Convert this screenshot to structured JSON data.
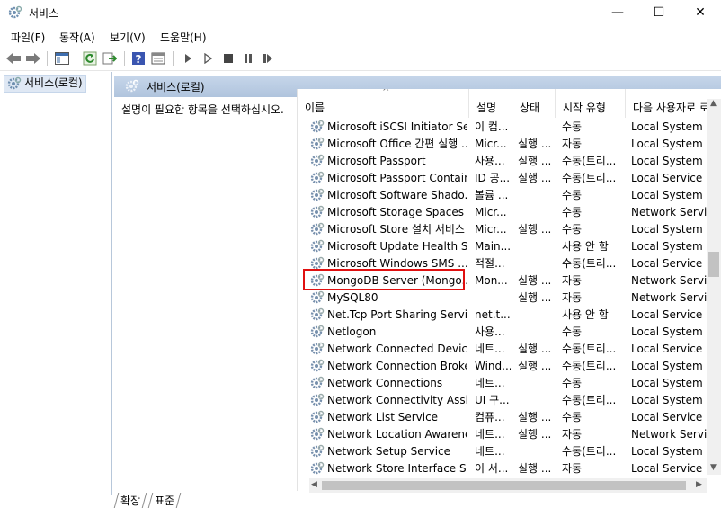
{
  "window": {
    "title": "서비스",
    "minimize": "—",
    "maximize": "☐",
    "close": "✕"
  },
  "menu": [
    "파일(F)",
    "동작(A)",
    "보기(V)",
    "도움말(H)"
  ],
  "toolbar": {
    "icons": [
      "back-arrow-icon",
      "forward-arrow-icon",
      "show-hide-tree-icon",
      "refresh-icon",
      "export-list-icon",
      "help-icon",
      "properties-icon",
      "start-service-icon",
      "start-service-alt-icon",
      "stop-service-icon",
      "pause-service-icon",
      "restart-service-icon"
    ]
  },
  "tree": {
    "label": "서비스(로컬)"
  },
  "pane": {
    "title": "서비스(로컬)",
    "description": "설명이 필요한 항목을 선택하십시오."
  },
  "columns": [
    "이름",
    "설명",
    "상태",
    "시작 유형",
    "다음 사용자로 로그온"
  ],
  "rows": [
    {
      "name": "Microsoft iSCSI Initiator Se...",
      "desc": "이 컴...",
      "status": "",
      "startup": "수동",
      "logon": "Local System"
    },
    {
      "name": "Microsoft Office 간편 실행 ...",
      "desc": "Micr...",
      "status": "실행 ...",
      "startup": "자동",
      "logon": "Local System"
    },
    {
      "name": "Microsoft Passport",
      "desc": "사용...",
      "status": "실행 ...",
      "startup": "수동(트리...",
      "logon": "Local System"
    },
    {
      "name": "Microsoft Passport Container",
      "desc": "ID 공...",
      "status": "실행 ...",
      "startup": "수동(트리...",
      "logon": "Local Service"
    },
    {
      "name": "Microsoft Software Shado...",
      "desc": "볼륨 ...",
      "status": "",
      "startup": "수동",
      "logon": "Local System"
    },
    {
      "name": "Microsoft Storage Spaces ...",
      "desc": "Micr...",
      "status": "",
      "startup": "수동",
      "logon": "Network Service"
    },
    {
      "name": "Microsoft Store 설치 서비스",
      "desc": "Micr...",
      "status": "실행 ...",
      "startup": "수동",
      "logon": "Local System"
    },
    {
      "name": "Microsoft Update Health S...",
      "desc": "Main...",
      "status": "",
      "startup": "사용 안 함",
      "logon": "Local System"
    },
    {
      "name": "Microsoft Windows SMS ...",
      "desc": "적절...",
      "status": "",
      "startup": "수동(트리...",
      "logon": "Local Service"
    },
    {
      "name": "MongoDB Server (Mongo...",
      "desc": "Mon...",
      "status": "실행 ...",
      "startup": "자동",
      "logon": "Network Service"
    },
    {
      "name": "MySQL80",
      "desc": "",
      "status": "실행 ...",
      "startup": "자동",
      "logon": "Network Service"
    },
    {
      "name": "Net.Tcp Port Sharing Service",
      "desc": "net.t...",
      "status": "",
      "startup": "사용 안 함",
      "logon": "Local Service"
    },
    {
      "name": "Netlogon",
      "desc": "사용...",
      "status": "",
      "startup": "수동",
      "logon": "Local System"
    },
    {
      "name": "Network Connected Device...",
      "desc": "네트...",
      "status": "실행 ...",
      "startup": "수동(트리...",
      "logon": "Local Service"
    },
    {
      "name": "Network Connection Broker",
      "desc": "Wind...",
      "status": "실행 ...",
      "startup": "수동(트리...",
      "logon": "Local System"
    },
    {
      "name": "Network Connections",
      "desc": "네트...",
      "status": "",
      "startup": "수동",
      "logon": "Local System"
    },
    {
      "name": "Network Connectivity Assis...",
      "desc": "UI 구...",
      "status": "",
      "startup": "수동(트리...",
      "logon": "Local System"
    },
    {
      "name": "Network List Service",
      "desc": "컴퓨...",
      "status": "실행 ...",
      "startup": "수동",
      "logon": "Local Service"
    },
    {
      "name": "Network Location Awareness",
      "desc": "네트...",
      "status": "실행 ...",
      "startup": "자동",
      "logon": "Network Service"
    },
    {
      "name": "Network Setup Service",
      "desc": "네트...",
      "status": "",
      "startup": "수동(트리...",
      "logon": "Local System"
    },
    {
      "name": "Network Store Interface Se...",
      "desc": "이 서...",
      "status": "실행 ...",
      "startup": "자동",
      "logon": "Local Service"
    }
  ],
  "selected_row_index": 9,
  "highlight_color": "#e01010",
  "tabs": [
    "확장",
    "표준"
  ]
}
